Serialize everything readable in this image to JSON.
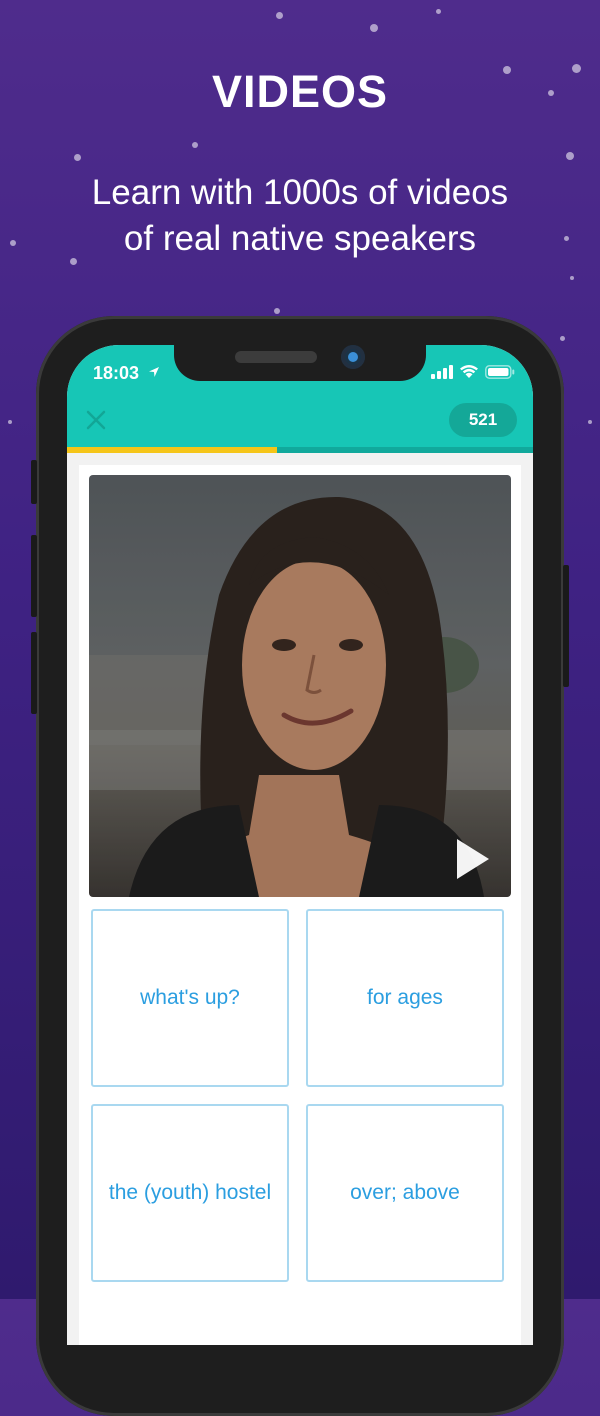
{
  "promo": {
    "headline": "VIDEOS",
    "subline_1": "Learn with 1000s of videos",
    "subline_2": "of real native speakers"
  },
  "status_bar": {
    "time": "18:03",
    "icons": [
      "location-arrow-icon",
      "signal-icon",
      "wifi-icon",
      "battery-icon"
    ]
  },
  "app_bar": {
    "close_icon": "close-icon",
    "score": "521",
    "progress_fraction": 0.45,
    "colors": {
      "bar": "#17c6b6",
      "progress": "#f5c518",
      "answer_text": "#2b9ee0"
    }
  },
  "video": {
    "play_icon": "play-icon"
  },
  "answers": [
    {
      "label": "what's up?"
    },
    {
      "label": "for ages"
    },
    {
      "label": "the (youth) hostel"
    },
    {
      "label": "over; above"
    }
  ]
}
